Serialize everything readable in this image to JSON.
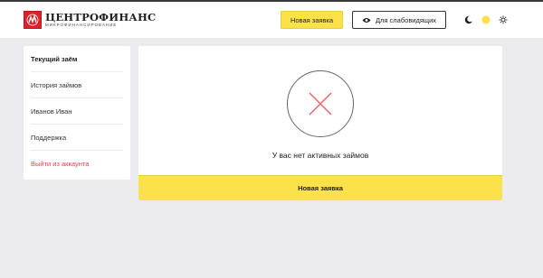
{
  "header": {
    "brand_name": "ЦЕНТРОФИНАНС",
    "brand_tagline": "МИКРОФИНАНСИРОВАНИЕ",
    "new_application_label": "Новая заявка",
    "visually_impaired_label": "Для слабовидящих",
    "theme_icons": [
      "moon-icon",
      "toggle-icon",
      "sun-icon"
    ]
  },
  "sidebar": {
    "items": [
      {
        "label": "Текущий заём"
      },
      {
        "label": "История займов"
      },
      {
        "label": "Иванов Иван"
      },
      {
        "label": "Поддержка"
      },
      {
        "label": "Выйти из аккаунта"
      }
    ]
  },
  "main": {
    "empty_message": "У вас нет активных займов",
    "new_application_label": "Новая заявка"
  },
  "colors": {
    "accent_yellow": "#fbe24a",
    "brand_red": "#d7262d",
    "logout_red": "#e2424a",
    "empty_x": "#e8606a",
    "background": "#ebebed"
  }
}
